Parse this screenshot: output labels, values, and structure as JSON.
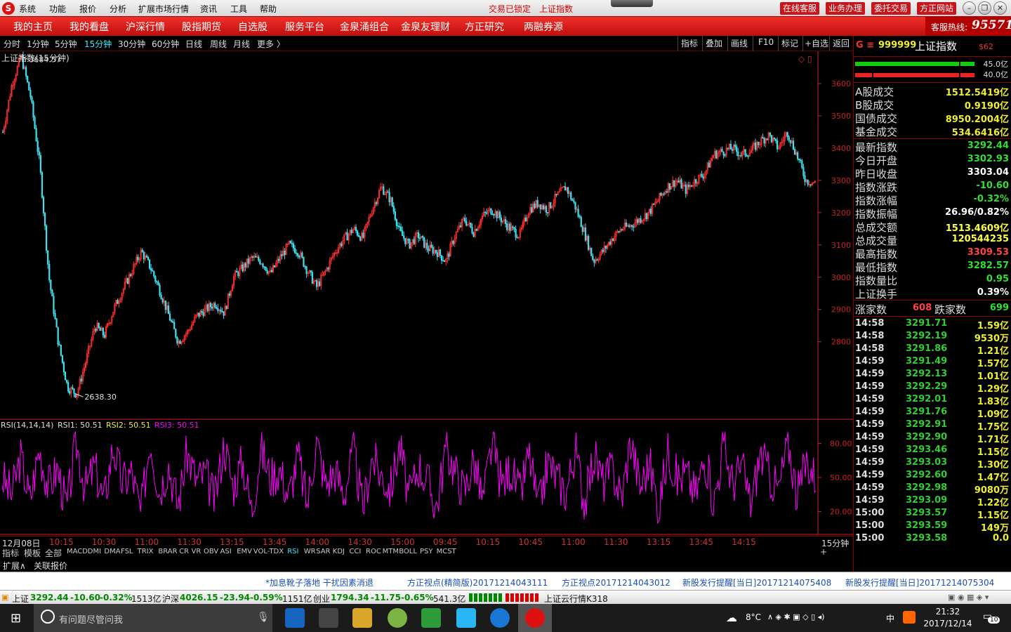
{
  "menubar": {
    "items": [
      "系统",
      "功能",
      "报价",
      "分析",
      "扩展市场行情",
      "资讯",
      "工具",
      "帮助"
    ],
    "status_locked": "交易已锁定",
    "status_index": "上证指数",
    "right_buttons": [
      "在线客服",
      "业务办理",
      "委托交易",
      "方正网站"
    ],
    "win_min": "–",
    "win_restore": "❐",
    "win_close": "✕"
  },
  "navbar": {
    "items": [
      "我的主页",
      "我的看盘",
      "沪深行情",
      "股指期货",
      "自选股",
      "服务平台",
      "金泉涌组合",
      "金泉友理财",
      "方正研究",
      "两融券源"
    ],
    "hotline_label": "客服热线:",
    "hotline_number": "95571"
  },
  "periodbar": {
    "periods": [
      "分时",
      "1分钟",
      "5分钟",
      "15分钟",
      "30分钟",
      "60分钟",
      "日线",
      "周线",
      "月线",
      "更多 〉"
    ],
    "active_period": "15分钟",
    "tools": [
      "指标",
      "叠加",
      "画线",
      "F10",
      "标记",
      "+自选",
      "返回"
    ]
  },
  "chart": {
    "title": "上证指数(15分钟)",
    "high_label": "3684.57",
    "low_label": "2638.30",
    "rsi_title": "RSI(14,14,14)",
    "rsi1": "RSI1: 50.51",
    "rsi2": "RSI2: 50.51",
    "rsi3": "RSI3: 50.51",
    "colors": {
      "candle_up": "#ff3030",
      "candle_down": "#40e0f0",
      "rsi": "#ff00ff",
      "axis": "#cc2222"
    }
  },
  "chart_data": {
    "type": "line",
    "title": "上证指数(15分钟)",
    "y_ticks": [
      2800,
      2900,
      3000,
      3100,
      3200,
      3300,
      3400,
      3500,
      3600
    ],
    "ylim": [
      2560,
      3700
    ],
    "x_labels": [
      "12月08日",
      "10:15",
      "10:30",
      "11:00",
      "11:30",
      "13:15",
      "13:45",
      "14:00",
      "14:30",
      "15:00",
      "09:45",
      "10:15",
      "10:45",
      "11:00",
      "11:30",
      "13:15",
      "13:45",
      "14:15"
    ],
    "x_label_right": "15分钟",
    "series": [
      {
        "values": [
          3450,
          3600,
          3684,
          3560,
          3350,
          3000,
          2800,
          2660,
          2638,
          2740,
          2850,
          2820,
          2900,
          2960,
          3020,
          3080,
          3030,
          2960,
          2880,
          2800,
          2830,
          2880,
          2900,
          2920,
          2890,
          3000,
          3030,
          3060,
          3050,
          3010,
          3060,
          3100,
          3080,
          3020,
          2970,
          3020,
          3080,
          3120,
          3150,
          3120,
          3210,
          3280,
          3240,
          3140,
          3100,
          3130,
          3090,
          3080,
          3050,
          3130,
          3180,
          3140,
          3190,
          3210,
          3180,
          3150,
          3130,
          3210,
          3230,
          3210,
          3250,
          3280,
          3220,
          3140,
          3050,
          3080,
          3120,
          3150,
          3160,
          3180,
          3200,
          3240,
          3280,
          3300,
          3270,
          3300,
          3320,
          3380,
          3390,
          3400,
          3380,
          3390,
          3420,
          3440,
          3400,
          3450,
          3380,
          3300,
          3292
        ]
      }
    ],
    "rsi": {
      "y_ticks": [
        20,
        50,
        80
      ],
      "ylim": [
        0,
        100
      ],
      "values": [
        50,
        35,
        68,
        30,
        75,
        42,
        58,
        22,
        82,
        40,
        60,
        28,
        78,
        45,
        55,
        18,
        85,
        38,
        62,
        25,
        72,
        48,
        53,
        30,
        80,
        42,
        65,
        20,
        76,
        50,
        58,
        33,
        70,
        26,
        83,
        44,
        56,
        36,
        74,
        22,
        68,
        52,
        40,
        79,
        31,
        61,
        47,
        24,
        77,
        55,
        38,
        66,
        29,
        81,
        43,
        59,
        34,
        71,
        21,
        64,
        50,
        37,
        75,
        27,
        69,
        46,
        57,
        32,
        84,
        41,
        63,
        23,
        73,
        49,
        54,
        35,
        67,
        28,
        79,
        45,
        60,
        26,
        72,
        51,
        39,
        82,
        33,
        65,
        50
      ]
    }
  },
  "indicators": {
    "lead": [
      "指标",
      "模板",
      "全部"
    ],
    "items": [
      "MACD",
      "DMI",
      "DMA",
      "FSL",
      "TRIX",
      "BRAR",
      "CR",
      "VR",
      "OBV",
      "ASI",
      "EMV",
      "VOL-TDX",
      "RSI",
      "WR",
      "SAR",
      "KDJ",
      "CCI",
      "ROC",
      "MTM",
      "BOLL",
      "PSY",
      "MCST"
    ],
    "active": "RSI",
    "bottom": [
      "扩展∧",
      "关联报价"
    ]
  },
  "panel": {
    "code_prefix": "G ≡",
    "code": "999999",
    "name": "上证指数",
    "badge": "$62",
    "bar1_pct": "45.0亿",
    "bar2_pct": "40.0亿",
    "turnover": [
      {
        "label": "A股成交",
        "value": "1512.5419亿"
      },
      {
        "label": "B股成交",
        "value": "0.9190亿"
      },
      {
        "label": "国债成交",
        "value": "8950.2004亿"
      },
      {
        "label": "基金成交",
        "value": "534.6416亿"
      }
    ],
    "stats": [
      {
        "label": "最新指数",
        "value": "3292.44",
        "color": "#33dd33"
      },
      {
        "label": "今日开盘",
        "value": "3302.93",
        "color": "#33dd33"
      },
      {
        "label": "昨日收盘",
        "value": "3303.04",
        "color": "#ffffff"
      },
      {
        "label": "指数涨跌",
        "value": "-10.60",
        "color": "#33dd33"
      },
      {
        "label": "指数涨幅",
        "value": "-0.32%",
        "color": "#33dd33"
      },
      {
        "label": "指数振幅",
        "value": "26.96/0.82%",
        "color": "#ffffff"
      },
      {
        "label": "总成交额",
        "value": "1513.4609亿",
        "color": "#ffff44"
      },
      {
        "label": "总成交量",
        "value": "120544235",
        "color": "#ffff44"
      },
      {
        "label": "最高指数",
        "value": "3309.53",
        "color": "#ff4444"
      },
      {
        "label": "最低指数",
        "value": "3282.57",
        "color": "#33dd33"
      },
      {
        "label": "指数量比",
        "value": "0.95",
        "color": "#33dd33"
      },
      {
        "label": "上证换手",
        "value": "0.39%",
        "color": "#ffffff"
      }
    ],
    "up_label": "涨家数",
    "up_count": "608",
    "down_label": "跌家数",
    "down_count": "699",
    "ticks": [
      {
        "t": "14:58",
        "p": "3291.71",
        "v": "1.59亿"
      },
      {
        "t": "14:58",
        "p": "3292.19",
        "v": "9530万"
      },
      {
        "t": "14:58",
        "p": "3291.86",
        "v": "1.21亿"
      },
      {
        "t": "14:59",
        "p": "3291.49",
        "v": "1.57亿"
      },
      {
        "t": "14:59",
        "p": "3292.13",
        "v": "1.01亿"
      },
      {
        "t": "14:59",
        "p": "3292.29",
        "v": "1.29亿"
      },
      {
        "t": "14:59",
        "p": "3292.01",
        "v": "1.83亿"
      },
      {
        "t": "14:59",
        "p": "3291.76",
        "v": "1.09亿"
      },
      {
        "t": "14:59",
        "p": "3292.91",
        "v": "1.75亿"
      },
      {
        "t": "14:59",
        "p": "3292.90",
        "v": "1.71亿"
      },
      {
        "t": "14:59",
        "p": "3293.46",
        "v": "1.15亿"
      },
      {
        "t": "14:59",
        "p": "3293.03",
        "v": "1.30亿"
      },
      {
        "t": "14:59",
        "p": "3292.60",
        "v": "1.47亿"
      },
      {
        "t": "14:59",
        "p": "3292.98",
        "v": "9080万"
      },
      {
        "t": "14:59",
        "p": "3293.09",
        "v": "1.22亿"
      },
      {
        "t": "15:00",
        "p": "3293.57",
        "v": "1.15亿"
      },
      {
        "t": "15:00",
        "p": "3293.59",
        "v": "149万"
      },
      {
        "t": "15:00",
        "p": "3293.58",
        "v": "0.0"
      }
    ]
  },
  "ticker": {
    "items": [
      "*加息靴子落地  干扰因素消退",
      "方正视点(精简版)20171214043111",
      "方正视点20171214043012",
      "新股发行提醒[当日]20171214075408",
      "新股发行提醒[当日]20171214075304"
    ]
  },
  "indexbar": {
    "sh_label": "上证",
    "sh_value": "3292.44",
    "sh_change": "-10.60",
    "sh_pct": "-0.32%",
    "sh_amount": "1513亿",
    "sz_label": "沪深",
    "sz_value": "4026.15",
    "sz_change": "-23.94",
    "sz_pct": "-0.59%",
    "sz_amount": "1151亿",
    "cy_label": "创业",
    "cy_value": "1794.34",
    "cy_change": "-11.75",
    "cy_pct": "-0.65%",
    "cy_amount": "541.3亿",
    "cloud": "上证云行情K318"
  },
  "taskbar": {
    "search_placeholder": "有问题尽管问我",
    "temp": "8°C",
    "ime": "中",
    "time": "21:32",
    "date": "2017/12/14",
    "notif": "10"
  }
}
